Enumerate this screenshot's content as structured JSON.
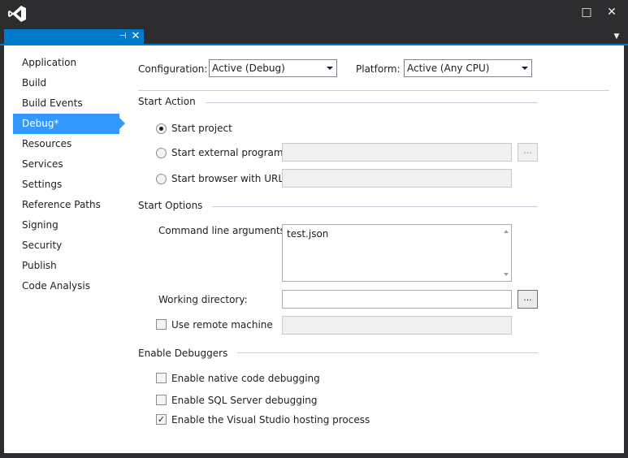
{
  "window": {
    "maximize_glyph": "□",
    "close_glyph": "✕"
  },
  "tab": {
    "pin_glyph": "⊣",
    "close_glyph": "✕",
    "dropdown_glyph": "▼"
  },
  "sidebar": {
    "items": [
      {
        "label": "Application",
        "selected": false
      },
      {
        "label": "Build",
        "selected": false
      },
      {
        "label": "Build Events",
        "selected": false
      },
      {
        "label": "Debug*",
        "selected": true
      },
      {
        "label": "Resources",
        "selected": false
      },
      {
        "label": "Services",
        "selected": false
      },
      {
        "label": "Settings",
        "selected": false
      },
      {
        "label": "Reference Paths",
        "selected": false
      },
      {
        "label": "Signing",
        "selected": false
      },
      {
        "label": "Security",
        "selected": false
      },
      {
        "label": "Publish",
        "selected": false
      },
      {
        "label": "Code Analysis",
        "selected": false
      }
    ]
  },
  "toolbar": {
    "configuration_label": "Configuration:",
    "configuration_value": "Active (Debug)",
    "platform_label": "Platform:",
    "platform_value": "Active (Any CPU)"
  },
  "start_action": {
    "heading": "Start Action",
    "start_project": "Start project",
    "start_external": "Start external program:",
    "start_browser": "Start browser with URL:",
    "browse_label": "...",
    "selected": "start_project"
  },
  "start_options": {
    "heading": "Start Options",
    "cmd_args_label": "Command line arguments:",
    "cmd_args_value": "test.json",
    "working_dir_label": "Working directory:",
    "working_dir_value": "",
    "browse_label": "...",
    "remote_label": "Use remote machine",
    "remote_checked": false
  },
  "enable_debuggers": {
    "heading": "Enable Debuggers",
    "native_label": "Enable native code debugging",
    "native_checked": false,
    "sql_label": "Enable SQL Server debugging",
    "sql_checked": false,
    "hosting_label": "Enable the Visual Studio hosting process",
    "hosting_checked": true,
    "check_glyph": "✓"
  },
  "colors": {
    "accent": "#007acc",
    "selection": "#3399ff",
    "chrome": "#2d2d30"
  }
}
